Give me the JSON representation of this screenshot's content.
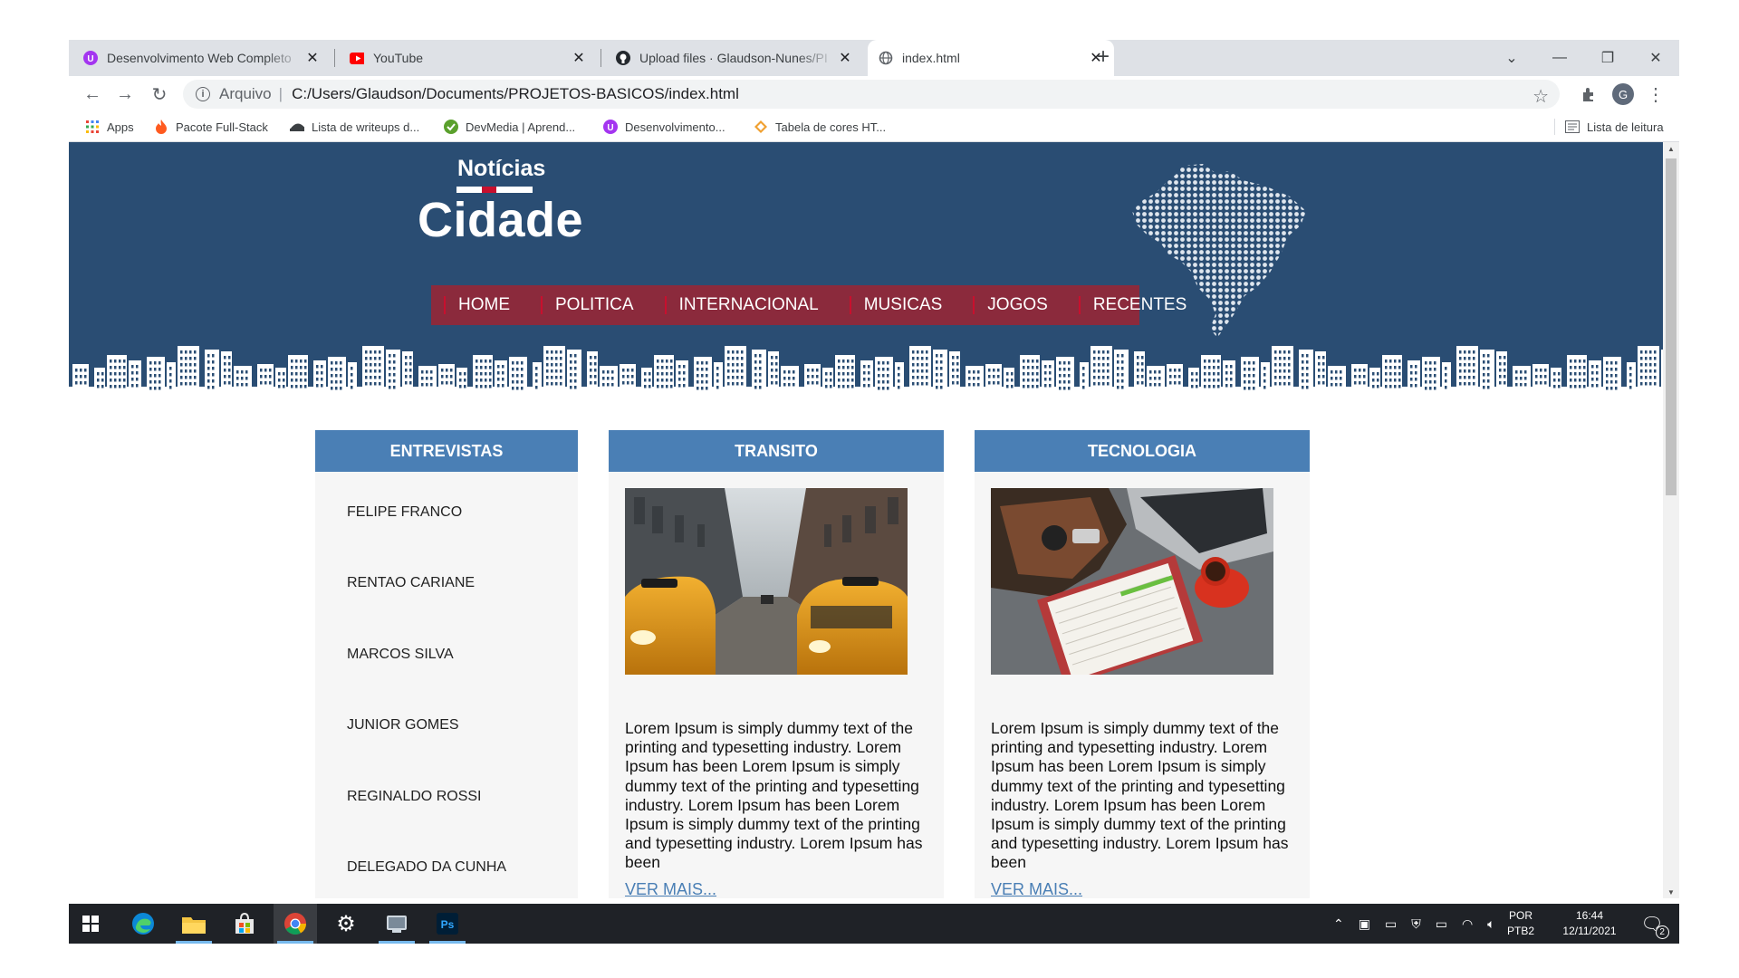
{
  "browser": {
    "tabs": [
      {
        "title": "Desenvolvimento Web Completo",
        "icon": "udemy-icon",
        "active": false
      },
      {
        "title": "YouTube",
        "icon": "youtube-icon",
        "active": false
      },
      {
        "title": "Upload files · Glaudson-Nunes/PI",
        "icon": "github-icon",
        "active": false
      },
      {
        "title": "index.html",
        "icon": "globe-icon",
        "active": true
      }
    ],
    "address": {
      "protocol_label": "Arquivo",
      "url": "C:/Users/Glaudson/Documents/PROJETOS-BASICOS/index.html"
    },
    "profile_initial": "G",
    "bookmarks": [
      {
        "label": "Apps",
        "icon": "apps-grid-icon"
      },
      {
        "label": "Pacote Full-Stack",
        "icon": "flame-icon"
      },
      {
        "label": "Lista de writeups d...",
        "icon": "hat-icon"
      },
      {
        "label": "DevMedia | Aprend...",
        "icon": "devmedia-icon"
      },
      {
        "label": "Desenvolvimento...",
        "icon": "udemy-icon"
      },
      {
        "label": "Tabela de cores HT...",
        "icon": "color-icon"
      }
    ],
    "reading_list": "Lista de leitura"
  },
  "site": {
    "logo": {
      "top": "Notícias",
      "bottom": "Cidade"
    },
    "menu": [
      "HOME",
      "POLITICA",
      "INTERNACIONAL",
      "MUSICAS",
      "JOGOS",
      "RECENTES"
    ],
    "columns": {
      "entrevistas": {
        "title": "ENTREVISTAS",
        "items": [
          "FELIPE FRANCO",
          "RENTAO CARIANE",
          "MARCOS SILVA",
          "JUNIOR GOMES",
          "REGINALDO ROSSI",
          "DELEGADO DA CUNHA"
        ]
      },
      "transito": {
        "title": "TRANSITO",
        "image": "taxi-street-photo",
        "text": "Lorem Ipsum is simply dummy text of the printing and typesetting industry. Lorem Ipsum has been Lorem Ipsum is simply dummy text of the printing and typesetting industry. Lorem Ipsum has been Lorem Ipsum is simply dummy text of the printing and typesetting industry. Lorem Ipsum has been",
        "link": "VER MAIS..."
      },
      "tecnologia": {
        "title": "TECNOLOGIA",
        "image": "desk-laptop-notebook-photo",
        "text": "Lorem Ipsum is simply dummy text of the printing and typesetting industry. Lorem Ipsum has been Lorem Ipsum is simply dummy text of the printing and typesetting industry. Lorem Ipsum has been Lorem Ipsum is simply dummy text of the printing and typesetting industry. Lorem Ipsum has been",
        "link": "VER MAIS..."
      }
    },
    "colors": {
      "header": "#2a4d73",
      "menu": "#8b2a3c",
      "column_head": "#4a7fb5",
      "accent_red": "#c8102e"
    }
  },
  "taskbar": {
    "apps": [
      "windows-start-icon",
      "edge-icon",
      "file-explorer-icon",
      "store-icon",
      "chrome-icon",
      "settings-icon",
      "app-icon",
      "photoshop-icon"
    ],
    "language": {
      "line1": "POR",
      "line2": "PTB2"
    },
    "clock": {
      "time": "16:44",
      "date": "12/11/2021"
    },
    "notifications": "2"
  }
}
